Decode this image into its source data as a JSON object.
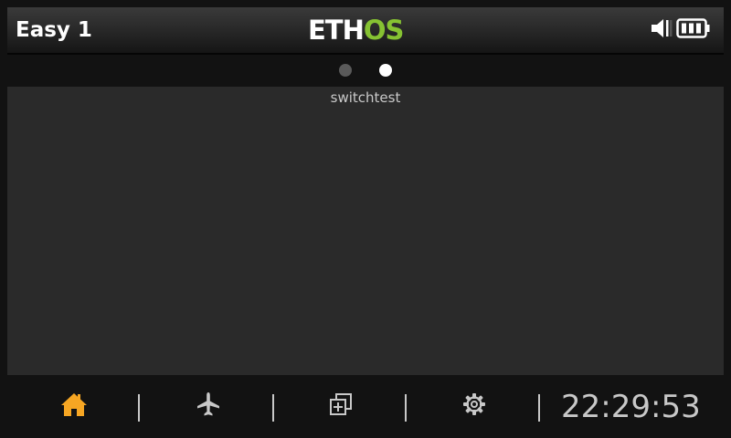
{
  "header": {
    "model_name": "Easy 1",
    "logo": {
      "part1": "ETH",
      "part2": "OS"
    },
    "status": {
      "speaker_icon": "speaker-icon",
      "battery_icon": "battery-icon",
      "battery_bars": 3
    }
  },
  "pages": {
    "total": 2,
    "current": 2
  },
  "widget": {
    "title": "switchtest"
  },
  "nav": {
    "items": [
      {
        "icon": "home-icon",
        "active": true
      },
      {
        "icon": "airplane-icon",
        "active": false
      },
      {
        "icon": "system-icon",
        "active": false
      },
      {
        "icon": "gear-icon",
        "active": false
      }
    ]
  },
  "clock": {
    "time": "22:29:53"
  },
  "colors": {
    "accent_active": "#f6a623",
    "logo_green": "#86c232",
    "icon_default": "#c8c8c8"
  }
}
